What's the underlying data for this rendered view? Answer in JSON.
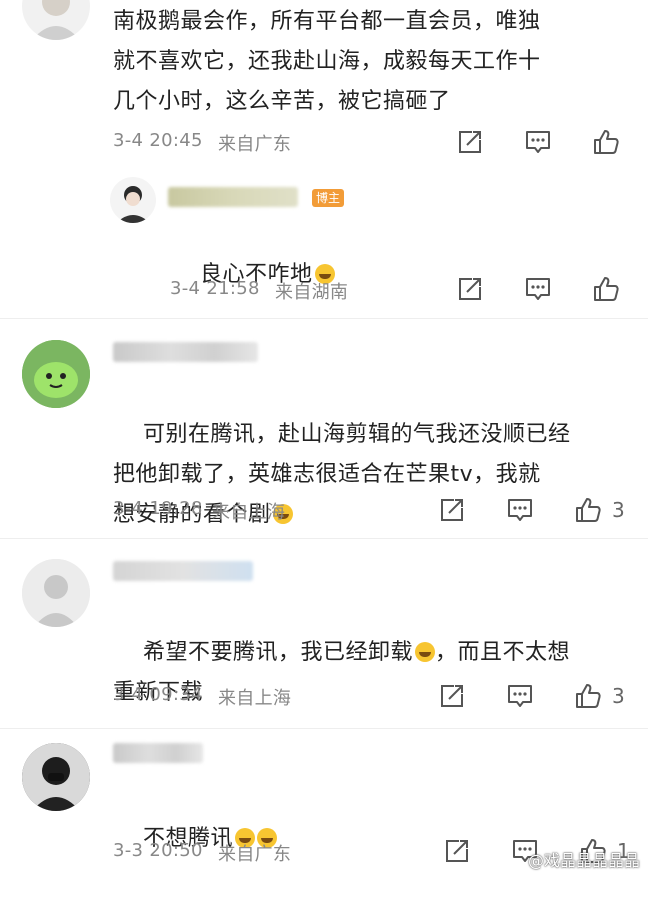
{
  "comments": [
    {
      "text": "南极鹅最会作，所有平台都一直会员，唯独\n就不喜欢它，还我赴山海，成毅每天工作十\n几个小时，这么辛苦，被它搞砸了",
      "time": "3-4 20:45",
      "location": "来自广东",
      "like_count": ""
    },
    {
      "reply_badge": "博主",
      "text": "良心不咋地",
      "emoji": "laugh-cry",
      "time": "3-4 21:58",
      "location": "来自湖南",
      "like_count": ""
    },
    {
      "text": "可别在腾讯，赴山海剪辑的气我还没顺已经\n把他卸载了，英雄志很适合在芒果tv，我就\n想安静的看个剧",
      "emoji": "laugh-cry",
      "time": "3-4 19:28",
      "location": "来自上海",
      "like_count": "3"
    },
    {
      "text_a": "希望不要腾讯，我已经卸载",
      "text_b": "，而且不太想",
      "text_c": "重新下载",
      "time": "3-4 09:34",
      "location": "来自上海",
      "like_count": "3"
    },
    {
      "text": "不想腾讯",
      "time": "3-3 20:50",
      "location": "来自广东",
      "like_count": "1"
    }
  ],
  "icons": {
    "share": "share-icon",
    "comment": "comment-icon",
    "like": "thumbs-up-icon"
  },
  "watermark": "@戏晶晶晶晶晶",
  "colors": {
    "text": "#222222",
    "meta": "#888888",
    "icon": "#555555",
    "badge": "#f29c38"
  }
}
